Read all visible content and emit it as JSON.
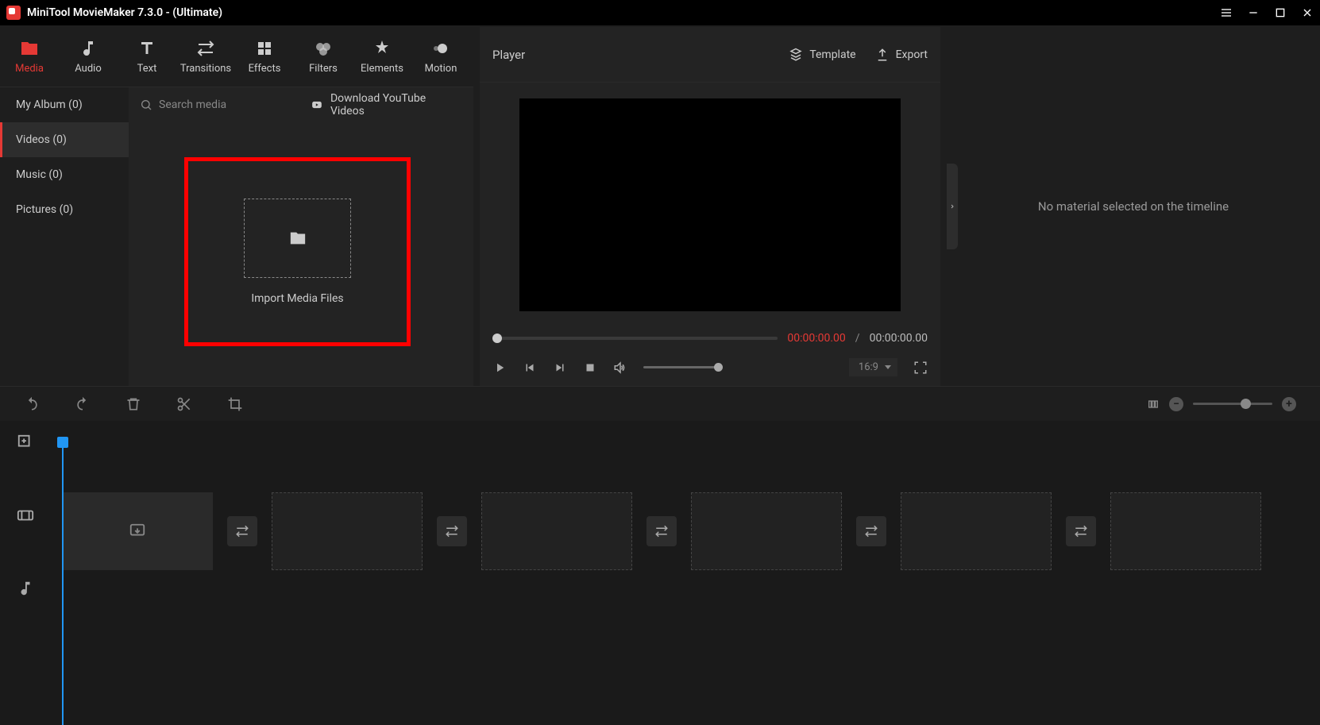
{
  "app": {
    "title": "MiniTool MovieMaker 7.3.0 - (Ultimate)"
  },
  "ribbon": {
    "items": [
      {
        "label": "Media",
        "active": true
      },
      {
        "label": "Audio"
      },
      {
        "label": "Text"
      },
      {
        "label": "Transitions"
      },
      {
        "label": "Effects"
      },
      {
        "label": "Filters"
      },
      {
        "label": "Elements"
      },
      {
        "label": "Motion"
      }
    ]
  },
  "sidebar": {
    "items": [
      {
        "label": "My Album (0)"
      },
      {
        "label": "Videos (0)",
        "active": true
      },
      {
        "label": "Music (0)"
      },
      {
        "label": "Pictures (0)"
      }
    ]
  },
  "search": {
    "placeholder": "Search media"
  },
  "download": {
    "label": "Download YouTube Videos"
  },
  "import": {
    "label": "Import Media Files"
  },
  "player": {
    "title": "Player",
    "template": "Template",
    "export": "Export",
    "time_current": "00:00:00.00",
    "time_separator": " / ",
    "time_total": "00:00:00.00",
    "ratio": "16:9"
  },
  "right_panel": {
    "empty": "No material selected on the timeline"
  }
}
